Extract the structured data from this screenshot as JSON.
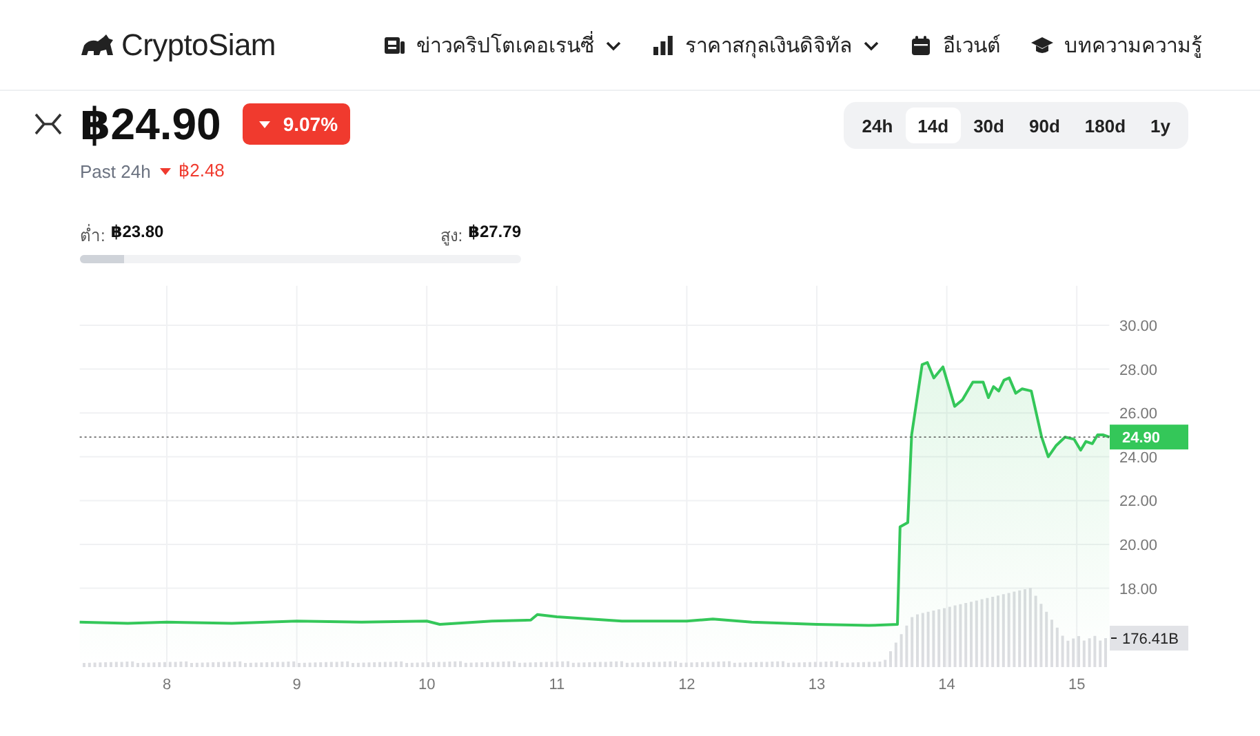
{
  "header": {
    "logo": "CryptoSiam",
    "nav": [
      {
        "label": "ข่าวคริปโตเคอเรนซี่",
        "dropdown": true
      },
      {
        "label": "ราคาสกุลเงินดิจิทัล",
        "dropdown": true
      },
      {
        "label": "อีเวนต์",
        "dropdown": false
      },
      {
        "label": "บทความความรู้",
        "dropdown": false
      }
    ]
  },
  "price": {
    "value": "฿24.90",
    "change": "9.07%",
    "falling": true,
    "past_label": "Past 24h",
    "past_change": "฿2.48"
  },
  "ranges": [
    {
      "label": "24h",
      "selected": false
    },
    {
      "label": "14d",
      "selected": true
    },
    {
      "label": "30d",
      "selected": false
    },
    {
      "label": "90d",
      "selected": false
    },
    {
      "label": "180d",
      "selected": false
    },
    {
      "label": "1y",
      "selected": false
    }
  ],
  "low_high": {
    "low_label": "ต่ำ:",
    "low": "฿23.80",
    "high_label": "สูง:",
    "high": "฿27.79",
    "level": 0.1
  },
  "chart": {
    "price_tag": "24.90",
    "volume_tag": "176.41B",
    "chart_data": {
      "type": "area",
      "grid": true,
      "xlim": [
        7.33,
        15.25
      ],
      "ylim": [
        14.4,
        31.8
      ],
      "ref_lines": [
        {
          "axis": "y",
          "value": 24.9
        }
      ],
      "xticks": [
        8,
        9,
        10,
        11,
        12,
        13,
        14,
        15
      ],
      "yticks": [
        {
          "value": 18,
          "label": "18.00"
        },
        {
          "value": 20,
          "label": "20.00"
        },
        {
          "value": 22,
          "label": "22.00"
        },
        {
          "value": 24,
          "label": "24.00"
        },
        {
          "value": 26,
          "label": "26.00"
        },
        {
          "value": 28,
          "label": "28.00"
        },
        {
          "value": 30,
          "label": "30.00"
        }
      ],
      "x": [
        7.33,
        7.7,
        8,
        8.5,
        9,
        9.5,
        10,
        10.1,
        10.5,
        10.8,
        10.85,
        11,
        11.5,
        12,
        12.2,
        12.5,
        13,
        13.4,
        13.62,
        13.64,
        13.7,
        13.73,
        13.81,
        13.85,
        13.9,
        13.97,
        14.06,
        14.12,
        14.2,
        14.28,
        14.32,
        14.36,
        14.4,
        14.44,
        14.48,
        14.53,
        14.58,
        14.65,
        14.73,
        14.78,
        14.84,
        14.91,
        14.98,
        15.03,
        15.07,
        15.12,
        15.16,
        15.2,
        15.25
      ],
      "series": [
        {
          "color": "#34c759",
          "values": [
            16.45,
            16.4,
            16.45,
            16.4,
            16.5,
            16.45,
            16.5,
            16.35,
            16.5,
            16.55,
            16.8,
            16.7,
            16.5,
            16.5,
            16.6,
            16.45,
            16.35,
            16.3,
            16.35,
            20.8,
            21.0,
            25.0,
            28.2,
            28.3,
            27.6,
            28.1,
            26.3,
            26.6,
            27.4,
            27.4,
            26.7,
            27.2,
            27.0,
            27.5,
            27.6,
            26.9,
            27.1,
            27.0,
            24.9,
            24.0,
            24.5,
            24.9,
            24.8,
            24.3,
            24.7,
            24.6,
            25.0,
            25.0,
            24.9
          ]
        }
      ]
    }
  }
}
